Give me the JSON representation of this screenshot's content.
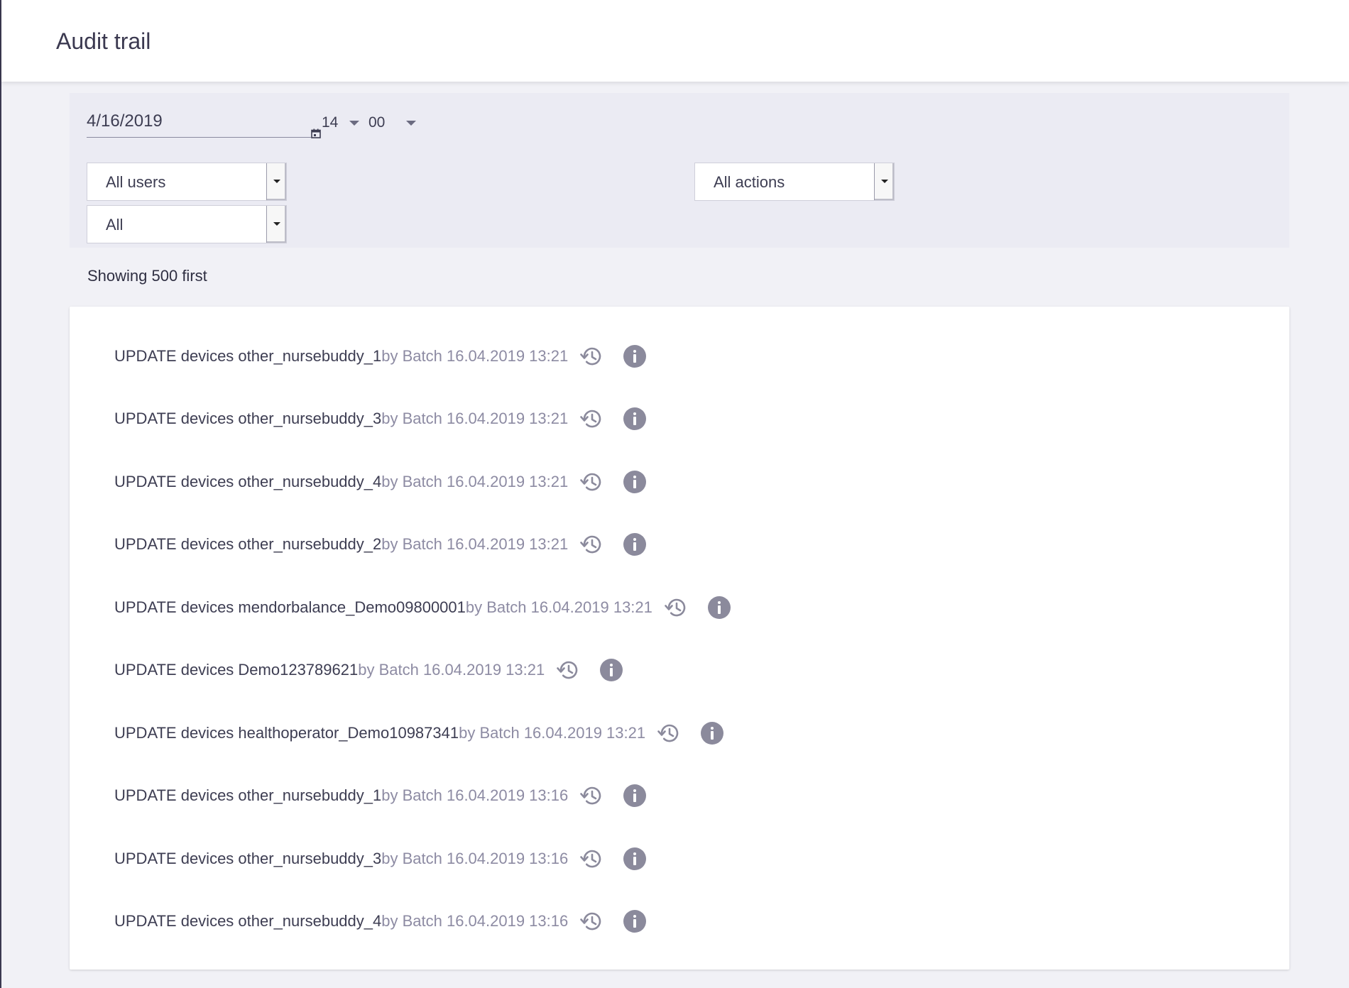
{
  "header": {
    "title": "Audit trail"
  },
  "filters": {
    "date": "4/16/2019",
    "hour": "14",
    "minute": "00",
    "user_select": "All users",
    "action_select": "All actions",
    "type_select": "All"
  },
  "status": {
    "showing": "Showing 500 first"
  },
  "icons": {
    "calendar": "calendar-icon",
    "history": "history-icon",
    "info": "info-icon"
  },
  "entries": [
    {
      "action": "UPDATE devices other_nursebuddy_1",
      "meta": "by Batch 16.04.2019 13:21"
    },
    {
      "action": "UPDATE devices other_nursebuddy_3",
      "meta": "by Batch 16.04.2019 13:21"
    },
    {
      "action": "UPDATE devices other_nursebuddy_4",
      "meta": "by Batch 16.04.2019 13:21"
    },
    {
      "action": "UPDATE devices other_nursebuddy_2",
      "meta": "by Batch 16.04.2019 13:21"
    },
    {
      "action": "UPDATE devices mendorbalance_Demo09800001",
      "meta": "by Batch 16.04.2019 13:21"
    },
    {
      "action": "UPDATE devices Demo123789621",
      "meta": "by Batch 16.04.2019 13:21"
    },
    {
      "action": "UPDATE devices healthoperator_Demo10987341",
      "meta": "by Batch 16.04.2019 13:21"
    },
    {
      "action": "UPDATE devices other_nursebuddy_1",
      "meta": "by Batch 16.04.2019 13:16"
    },
    {
      "action": "UPDATE devices other_nursebuddy_3",
      "meta": "by Batch 16.04.2019 13:16"
    },
    {
      "action": "UPDATE devices other_nursebuddy_4",
      "meta": "by Batch 16.04.2019 13:16"
    }
  ]
}
